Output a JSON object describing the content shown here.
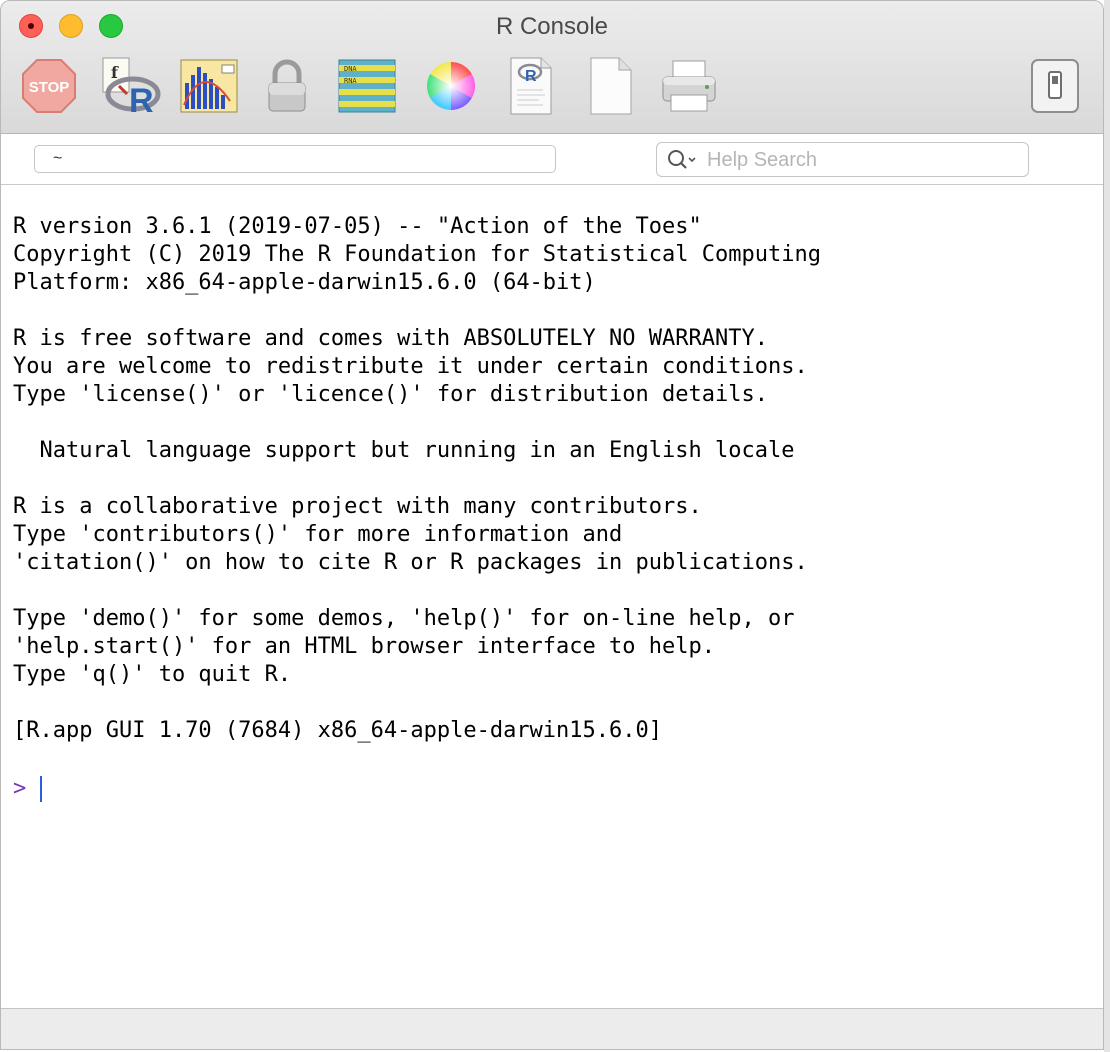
{
  "window": {
    "title": "R Console"
  },
  "toolbar": {
    "items": [
      {
        "icon": "stop-icon",
        "label": "STOP"
      },
      {
        "icon": "source-script-icon"
      },
      {
        "icon": "quartz-graphics-icon"
      },
      {
        "icon": "lock-icon"
      },
      {
        "icon": "workspace-browser-icon"
      },
      {
        "icon": "color-wheel-icon"
      },
      {
        "icon": "r-document-icon"
      },
      {
        "icon": "new-document-icon"
      },
      {
        "icon": "print-icon"
      },
      {
        "icon": "toggle-drawer-icon"
      }
    ]
  },
  "address": {
    "path": "~",
    "search_placeholder": "Help Search"
  },
  "console": {
    "lines": [
      "",
      "R version 3.6.1 (2019-07-05) -- \"Action of the Toes\"",
      "Copyright (C) 2019 The R Foundation for Statistical Computing",
      "Platform: x86_64-apple-darwin15.6.0 (64-bit)",
      "",
      "R is free software and comes with ABSOLUTELY NO WARRANTY.",
      "You are welcome to redistribute it under certain conditions.",
      "Type 'license()' or 'licence()' for distribution details.",
      "",
      "  Natural language support but running in an English locale",
      "",
      "R is a collaborative project with many contributors.",
      "Type 'contributors()' for more information and",
      "'citation()' on how to cite R or R packages in publications.",
      "",
      "Type 'demo()' for some demos, 'help()' for on-line help, or",
      "'help.start()' for an HTML browser interface to help.",
      "Type 'q()' to quit R.",
      "",
      "[R.app GUI 1.70 (7684) x86_64-apple-darwin15.6.0]"
    ],
    "prompt": ">"
  },
  "colors": {
    "prompt": "#7b36b1",
    "cursor": "#2c5de5"
  }
}
